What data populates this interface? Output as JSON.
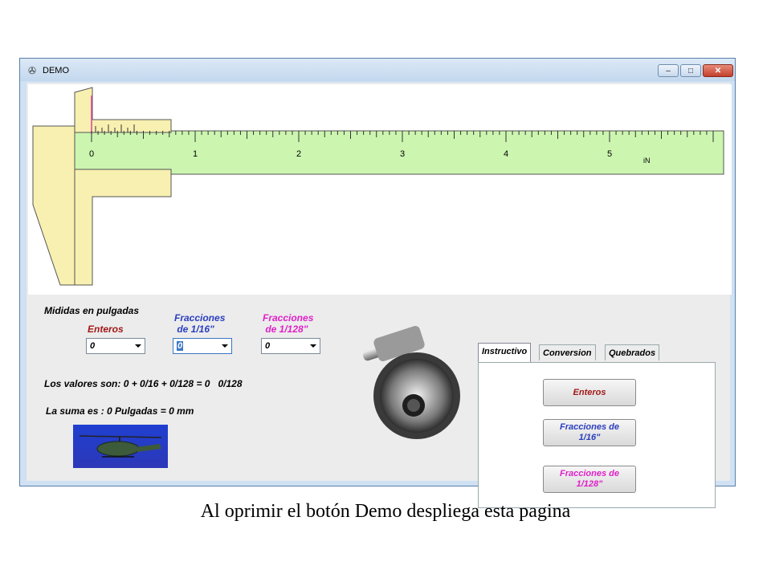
{
  "window": {
    "title": "DEMO",
    "controls": {
      "minimize": "–",
      "maximize": "□",
      "close": "✕"
    }
  },
  "ruler": {
    "scale_labels": [
      "0",
      "1",
      "2",
      "3",
      "4",
      "5"
    ],
    "unit": "iN",
    "colors": {
      "beam": "#ccf5b0",
      "jaw": "#f8f0b0",
      "indicator": "#e0409c"
    }
  },
  "measures": {
    "heading": "Mididas en pulgadas",
    "enteros": {
      "label": "Enteros",
      "value": "0",
      "color": "#a01818"
    },
    "fracciones16": {
      "label": "Fracciones\n de 1/16\"",
      "value": "0",
      "color": "#2a3fbf"
    },
    "fracciones128": {
      "label": "Fracciones\n de 1/128\"",
      "value": "0",
      "color": "#e020c8"
    }
  },
  "results": {
    "valores": "Los valores son: 0 + 0/16 + 0/128 = 0   0/128",
    "suma": "La suma es : 0 Pulgadas = 0 mm"
  },
  "images": {
    "helicopter": "helicopter-image",
    "gear": "gear-image"
  },
  "tabs": [
    {
      "label": "Instructivo",
      "active": true
    },
    {
      "label": "Conversion",
      "active": false
    },
    {
      "label": "Quebrados",
      "active": false
    }
  ],
  "buttons": {
    "enteros": "Enteros",
    "fracciones16": "Fracciones de\n1/16\"",
    "fracciones128": "Fracciones de\n1/128\""
  },
  "caption": "Al oprimir el botón Demo despliega esta pagina"
}
